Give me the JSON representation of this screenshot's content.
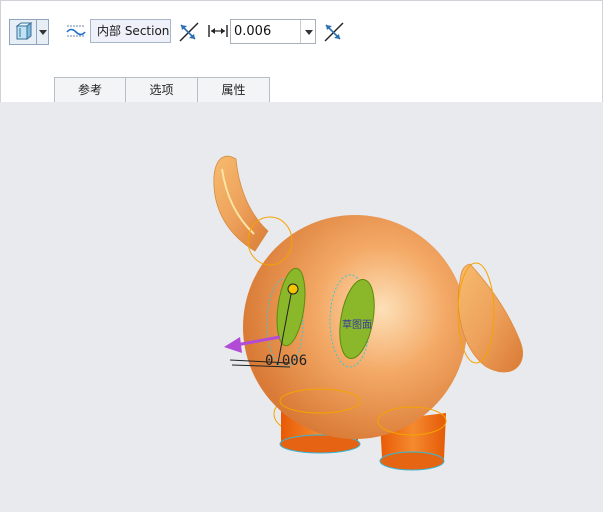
{
  "toolbar": {
    "mode_icon": "extrude-solid-icon",
    "section_type_icon": "wave-section-icon",
    "section_type_value": "内部 Section",
    "flip_icon": "flip-direction-icon",
    "distance_icon": "distance-icon",
    "distance_value": "0.006"
  },
  "tabs": [
    {
      "label": "参考"
    },
    {
      "label": "选项"
    },
    {
      "label": "属性"
    }
  ],
  "viewport": {
    "dimension_text": "0.006",
    "plane_label": "草图面",
    "colors": {
      "body": "#f2a25c",
      "legs": "#f06d10",
      "eye_fill": "#8ab82a",
      "arrow": "#b24bd6",
      "highlight_edge": "#f5b000"
    }
  }
}
